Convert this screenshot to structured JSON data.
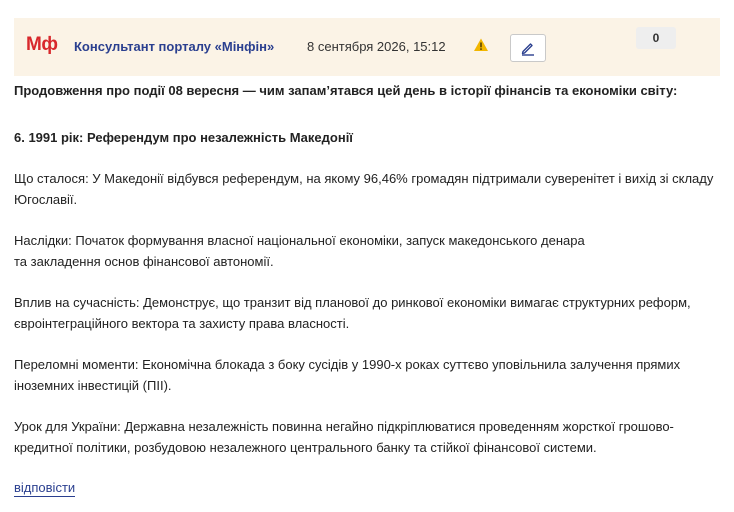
{
  "header": {
    "logo": "Мф",
    "author": "Консультант порталу «Мінфін»",
    "date": "8 сентября 2026, 15:12",
    "counter": "0",
    "warning_icon": "warning-icon",
    "edit_icon": "pencil-icon"
  },
  "post": {
    "intro": "Продовження про події 08 вересня — чим запам’ятався цей день в історії фінансів та економіки світу:",
    "title": "6. 1991 рік: Референдум про незалежність Македонії",
    "what_happened": "Що сталося: У Македонії відбувся референдум, на якому 96,46% громадян підтримали суверенітет і вихід зі складу Югославії.",
    "consequences_1": "Наслідки: Початок формування власної національної економіки, запуск македонського денара",
    "consequences_2": "та закладення основ фінансової автономії.",
    "influence": "Вплив на сучасність: Демонструє, що транзит від планової до ринкової економіки вимагає структурних реформ, євроінтеграційного вектора та захисту права власності.",
    "turning_points": "Переломні моменти: Економічна блокада з боку сусідів у 1990-х роках суттєво уповільнила залучення прямих іноземних інвестицій (ПІІ).",
    "lesson": "Урок для України: Державна незалежність повинна негайно підкріплюватися проведенням жорсткої грошово-кредитної політики, розбудовою незалежного центрального банку та стійкої фінансової системи."
  },
  "actions": {
    "reply": "відповісти"
  },
  "colors": {
    "logo": "#d8282c",
    "author": "#2a3f8f",
    "header_bg": "#fbf3e6",
    "warning": "#f2b600"
  }
}
